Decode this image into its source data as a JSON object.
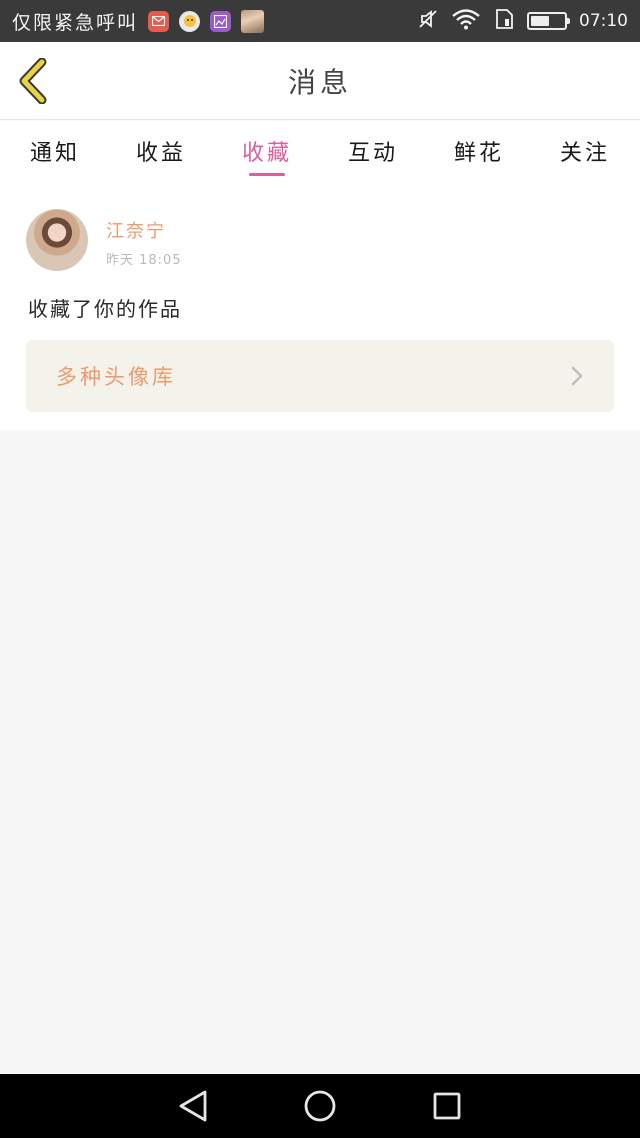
{
  "status_bar": {
    "carrier": "仅限紧急呼叫",
    "time": "07:10",
    "battery_level": 0.55,
    "notification_icons": [
      "mail-icon",
      "chat-icon",
      "gallery-icon",
      "photo-thumbnail"
    ],
    "system_icons": [
      "mute-icon",
      "wifi-icon",
      "sim-icon",
      "battery-icon"
    ]
  },
  "header": {
    "title": "消息",
    "back_icon": "chevron-left-icon",
    "accent_color": "#e8d24a"
  },
  "tabs": {
    "items": [
      "通知",
      "收益",
      "收藏",
      "互动",
      "鲜花",
      "关注"
    ],
    "active": "收藏",
    "active_color": "#d9609c"
  },
  "message": {
    "sender": "江奈宁",
    "time": "昨天 18:05",
    "text": "收藏了你的作品",
    "work_title": "多种头像库",
    "name_color": "#ec9a6e"
  },
  "nav_bar": {
    "buttons": [
      "back-triangle-icon",
      "home-circle-icon",
      "recents-square-icon"
    ]
  }
}
